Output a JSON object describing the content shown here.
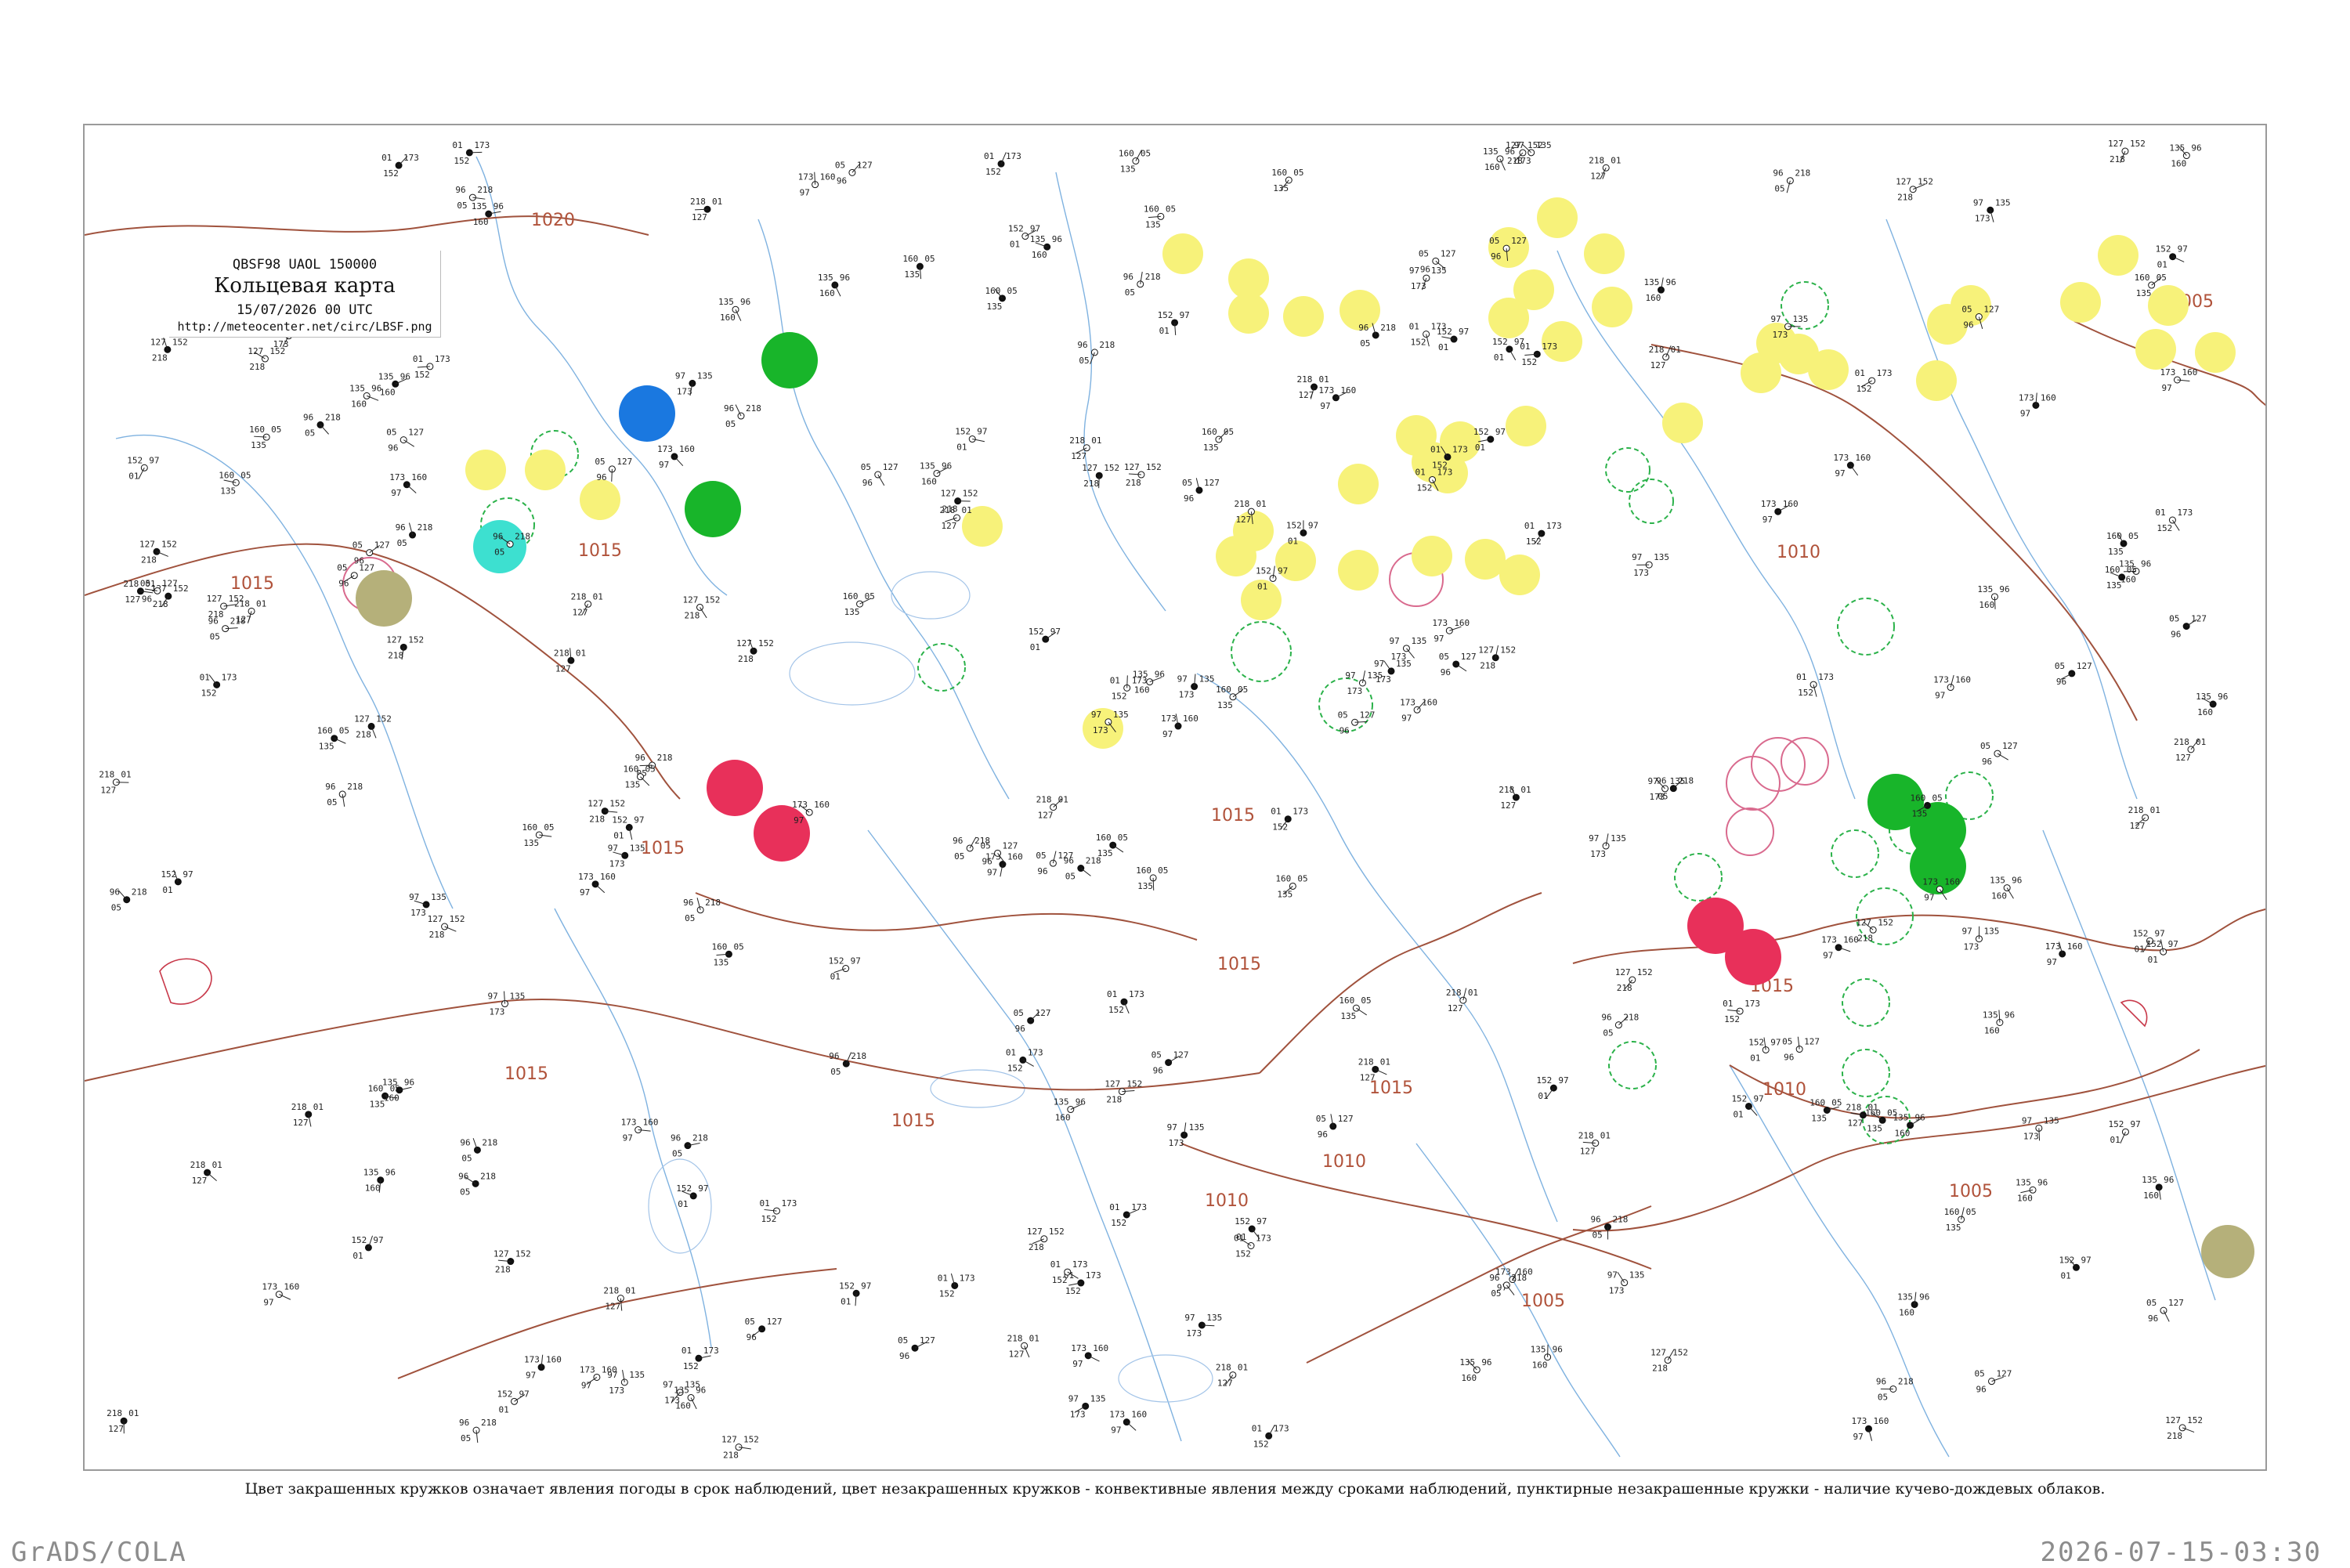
{
  "header": {
    "code": "QBSF98  UAOL  150000",
    "title": "Кольцевая карта",
    "time": "15/07/2026 00 UTC",
    "url": "http://meteocenter.net/circ/LBSF.png"
  },
  "caption": "Цвет закрашенных кружков означает явления погоды в срок наблюдений, цвет незакрашенных кружков - конвективные явления между сроками наблюдений, пунктирные незакрашенные кружки - наличие кучево-дождевых облаков.",
  "footer": {
    "software": "GrADS/COLA",
    "timestamp": "2026-07-15-03:30"
  },
  "isobar_labels": [
    "1020",
    "1015",
    "1015",
    "1015",
    "1015",
    "1015",
    "1015",
    "1010",
    "1010",
    "1015",
    "1010",
    "1005",
    "1005",
    "1005",
    "1015",
    "1010",
    "1015"
  ],
  "colors": {
    "isobar": "#a0523d",
    "rivers": "#7fb2e0",
    "coast": "#a3c4e8",
    "lake_outline": "#c8394a",
    "yellow_marker": "#f7f27a",
    "green_marker": "#18b52a",
    "red_marker": "#e8305a",
    "blue_marker": "#1a78e0",
    "cyan_marker": "#3de0d0",
    "olive_marker": "#b5b07a",
    "green_dashed": "#2bb24a",
    "red_outline": "#d96a8e"
  },
  "station_markers": [
    {
      "type": "yellow",
      "id": "y1"
    },
    {
      "type": "yellow",
      "id": "y2"
    },
    {
      "type": "yellow",
      "id": "y3"
    },
    {
      "type": "green",
      "id": "g1"
    },
    {
      "type": "red",
      "id": "r1"
    },
    {
      "type": "blue",
      "id": "b1"
    },
    {
      "type": "cyan",
      "id": "c1"
    },
    {
      "type": "olive",
      "id": "o1"
    }
  ],
  "sample_station_readings": [
    "160",
    "218",
    "97",
    "05",
    "01",
    "135",
    "127",
    "173",
    "96",
    "152"
  ]
}
